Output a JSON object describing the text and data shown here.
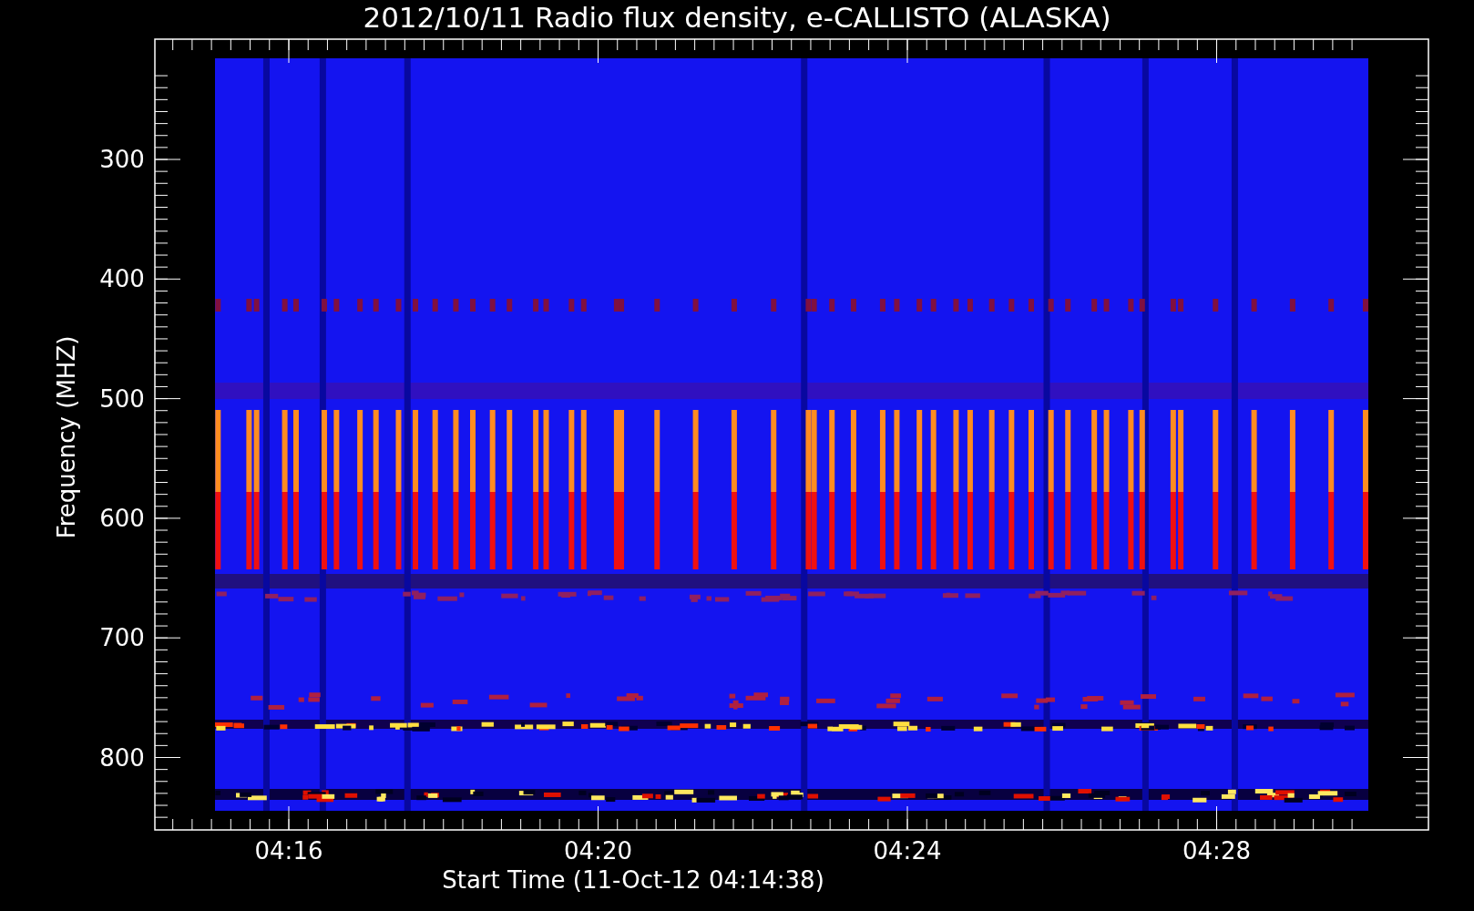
{
  "title": "2012/10/11  Radio flux density, e-CALLISTO (ALASKA)",
  "y_axis": {
    "label": "Frequency (MHZ)",
    "ticks": [
      "300",
      "400",
      "500",
      "600",
      "700",
      "800"
    ]
  },
  "x_axis": {
    "label": "Start Time (11-Oct-12 04:14:38)",
    "ticks": [
      "04:16",
      "04:20",
      "04:24",
      "04:28"
    ]
  }
}
